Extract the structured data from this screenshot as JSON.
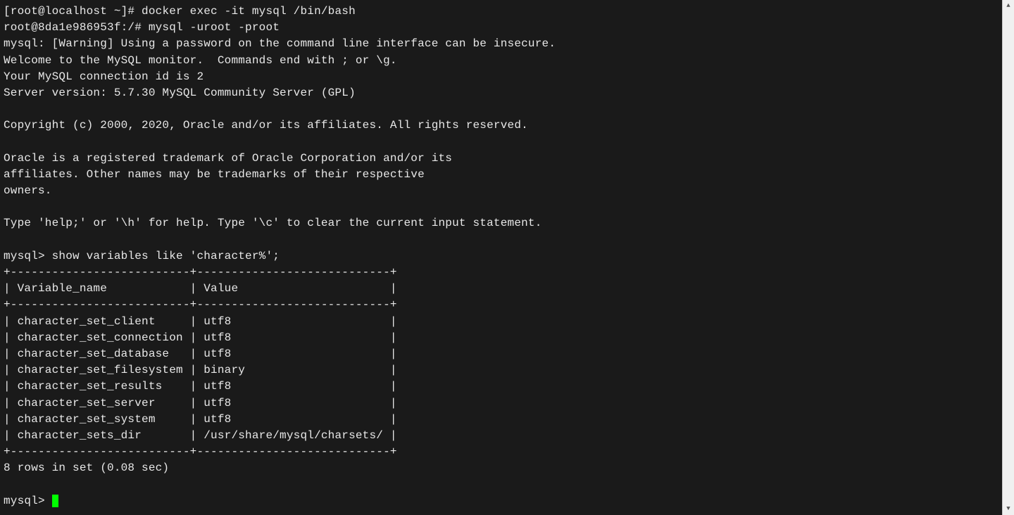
{
  "lines": {
    "l1_a": "[root@localhost ~]#",
    "l1_b": " docker exec -it mysql /bin/bash",
    "l2_a": "root@8da1e986953f:/#",
    "l2_b": " mysql -uroot -proot",
    "l3": "mysql: [Warning] Using a password on the command line interface can be insecure.",
    "l4": "Welcome to the MySQL monitor.  Commands end with ; or \\g.",
    "l5": "Your MySQL connection id is 2",
    "l6": "Server version: 5.7.30 MySQL Community Server (GPL)",
    "l7": "",
    "l8": "Copyright (c) 2000, 2020, Oracle and/or its affiliates. All rights reserved.",
    "l9": "",
    "l10": "Oracle is a registered trademark of Oracle Corporation and/or its",
    "l11": "affiliates. Other names may be trademarks of their respective",
    "l12": "owners.",
    "l13": "",
    "l14": "Type 'help;' or '\\h' for help. Type '\\c' to clear the current input statement.",
    "l15": "",
    "l16_a": "mysql>",
    "l16_b": " show variables like 'character%';",
    "t_border": "+--------------------------+----------------------------+",
    "t_header": "| Variable_name            | Value                      |",
    "r1": "| character_set_client     | utf8                       |",
    "r2": "| character_set_connection | utf8                       |",
    "r3": "| character_set_database   | utf8                       |",
    "r4": "| character_set_filesystem | binary                     |",
    "r5": "| character_set_results    | utf8                       |",
    "r6": "| character_set_server     | utf8                       |",
    "r7": "| character_set_system     | utf8                       |",
    "r8": "| character_sets_dir       | /usr/share/mysql/charsets/ |",
    "summary": "8 rows in set (0.08 sec)",
    "prompt": "mysql> "
  },
  "scroll": {
    "up": "▲",
    "down": "▼"
  },
  "chart_data": {
    "type": "table",
    "title": "show variables like 'character%'",
    "columns": [
      "Variable_name",
      "Value"
    ],
    "rows": [
      [
        "character_set_client",
        "utf8"
      ],
      [
        "character_set_connection",
        "utf8"
      ],
      [
        "character_set_database",
        "utf8"
      ],
      [
        "character_set_filesystem",
        "binary"
      ],
      [
        "character_set_results",
        "utf8"
      ],
      [
        "character_set_server",
        "utf8"
      ],
      [
        "character_set_system",
        "utf8"
      ],
      [
        "character_sets_dir",
        "/usr/share/mysql/charsets/"
      ]
    ],
    "row_count": 8,
    "elapsed_sec": 0.08
  }
}
